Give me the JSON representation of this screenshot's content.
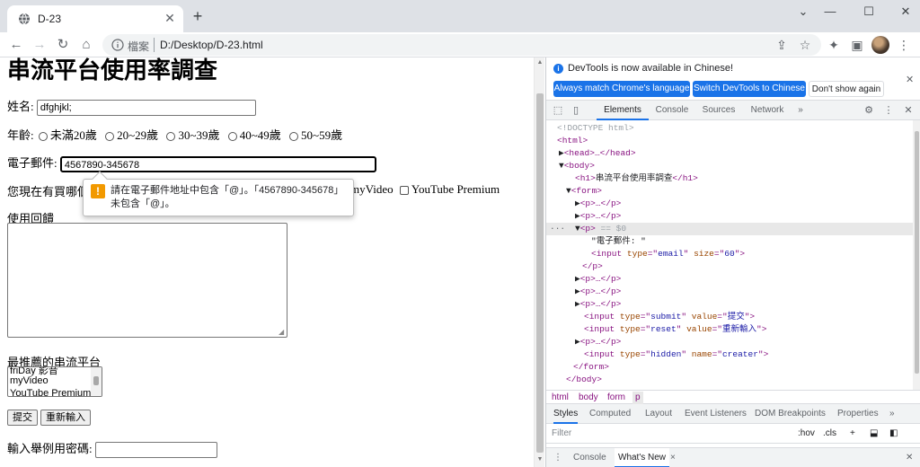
{
  "browser": {
    "tab_title": "D-23",
    "new_tab": "+",
    "omnibox_label": "檔案",
    "url": "D:/Desktop/D-23.html"
  },
  "page": {
    "title": "串流平台使用率調查",
    "name_label": "姓名:",
    "name_value": "dfghjkl;",
    "age_label": "年齡:",
    "age_options": [
      "未滿20歲",
      "20~29歲",
      "30~39歲",
      "40~49歲",
      "50~59歲"
    ],
    "email_label": "電子郵件:",
    "email_value": "4567890-345678",
    "services_label_start": "您現在有買哪個",
    "services_visible_tail": "myVideo",
    "services_last": "YouTube Premium",
    "feedback_label": "使用回饋",
    "recommend_label": "最推薦的串流平台",
    "listbox_options": [
      "friDay 影音",
      "myVideo",
      "YouTube Premium"
    ],
    "submit_label": "提交",
    "reset_label": "重新輸入",
    "password_label": "輸入舉例用密碼:",
    "validation_message": "請在電子郵件地址中包含「@」。「4567890-345678」未包含「@」。",
    "validation_icon": "!"
  },
  "devtools": {
    "info_text": "DevTools is now available in Chinese!",
    "btn_match": "Always match Chrome's language",
    "btn_switch": "Switch DevTools to Chinese",
    "btn_dont_show": "Don't show again",
    "tabs": [
      "Elements",
      "Console",
      "Sources",
      "Network"
    ],
    "more_tabs": "»",
    "dom": {
      "doctype": "<!DOCTYPE html>",
      "html_open": "<html>",
      "head": "<head>…</head>",
      "body_open": "<body>",
      "h1_open": "<h1>",
      "h1_text": "串流平台使用率調查",
      "h1_close": "</h1>",
      "form_open": "<form>",
      "p_collapsed": "<p>…</p>",
      "p_open": "<p>",
      "p_selected_marker": "== $0",
      "p_text": "\"電子郵件: \"",
      "input_email": [
        "<input ",
        "type",
        "=\"",
        "email",
        "\" ",
        "size",
        "=\"",
        "60",
        "\">"
      ],
      "p_close": "</p>",
      "input_submit": [
        "<input ",
        "type",
        "=\"",
        "submit",
        "\" ",
        "value",
        "=\"",
        "提交",
        "\">"
      ],
      "input_reset": [
        "<input ",
        "type",
        "=\"",
        "reset",
        "\" ",
        "value",
        "=\"",
        "重新輸入",
        "\">"
      ],
      "input_hidden": [
        "<input ",
        "type",
        "=\"",
        "hidden",
        "\" ",
        "name",
        "=\"",
        "creater",
        "\">"
      ],
      "form_close": "</form>",
      "body_close": "</body>",
      "gutter_dots": "···"
    },
    "breadcrumbs": [
      "html",
      "body",
      "form",
      "p"
    ],
    "style_tabs": [
      "Styles",
      "Computed",
      "Layout",
      "Event Listeners",
      "DOM Breakpoints",
      "Properties"
    ],
    "style_more": "»",
    "filter_placeholder": "Filter",
    "hov": ":hov",
    "cls": ".cls",
    "drawer_tabs": [
      "Console",
      "What's New"
    ],
    "drawer_close": "×"
  },
  "colors": {
    "accent": "#1a73e8",
    "warning": "#f29900",
    "tag": "#881280",
    "attr": "#994500",
    "value": "#1a1aa6"
  }
}
